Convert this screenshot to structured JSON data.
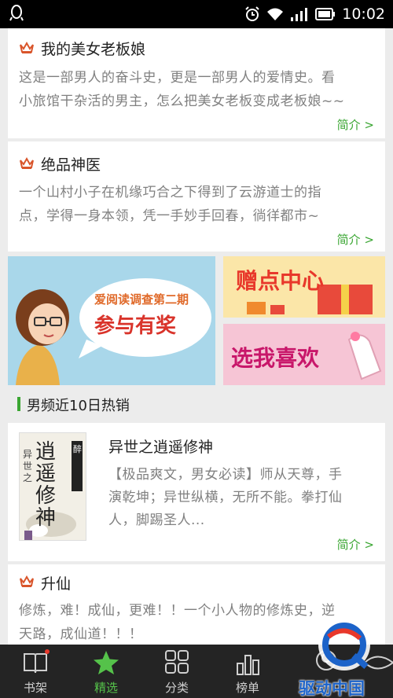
{
  "status_bar": {
    "time": "10:02",
    "icons": [
      "qq-icon",
      "alarm-icon",
      "wifi-icon",
      "signal-icon",
      "battery-icon"
    ]
  },
  "books": [
    {
      "title": "我的美女老板娘",
      "desc_lines": [
        "这是一部男人的奋斗史，更是一部男人的爱情史。看",
        "小旅馆干杂活的男主，怎么把美女老板变成老板娘~~"
      ],
      "more": "简介 >"
    },
    {
      "title": "绝品神医",
      "desc_lines": [
        "一个山村小子在机缘巧合之下得到了云游道士的指",
        "点，学得一身本领，凭一手妙手回春，徜徉都市~"
      ],
      "more": "简介 >"
    }
  ],
  "banners": {
    "left_line1": "爱阅读调查第二期",
    "left_line2": "参与有奖",
    "right_top": "赠点中心",
    "right_bottom": "选我喜欢"
  },
  "section": {
    "title": "男频近10日热销"
  },
  "featured": {
    "title": "异世之逍遥修神",
    "cover_text": "逍遥修神",
    "cover_side": "异世之",
    "cover_author": "醉",
    "desc_lines": [
      "【极品爽文，男女必读】师从天尊，手",
      "演乾坤；异世纵横，无所不能。拳打仙",
      "人，脚踢圣人..."
    ],
    "more": "简介 >"
  },
  "last_book": {
    "title": "升仙",
    "desc_lines": [
      "修炼，难！成仙，更难！！一个小人物的修炼史，逆",
      "天路，成仙道！！！"
    ]
  },
  "tabs": [
    {
      "label": "书架",
      "icon": "book-icon"
    },
    {
      "label": "精选",
      "icon": "star-icon"
    },
    {
      "label": "分类",
      "icon": "grid-icon"
    },
    {
      "label": "榜单",
      "icon": "bar-chart-icon"
    }
  ],
  "watermark": {
    "text": "驱动中国"
  },
  "colors": {
    "accent": "#3aa632",
    "crown": "#d9552b",
    "tabbar": "#242424"
  }
}
